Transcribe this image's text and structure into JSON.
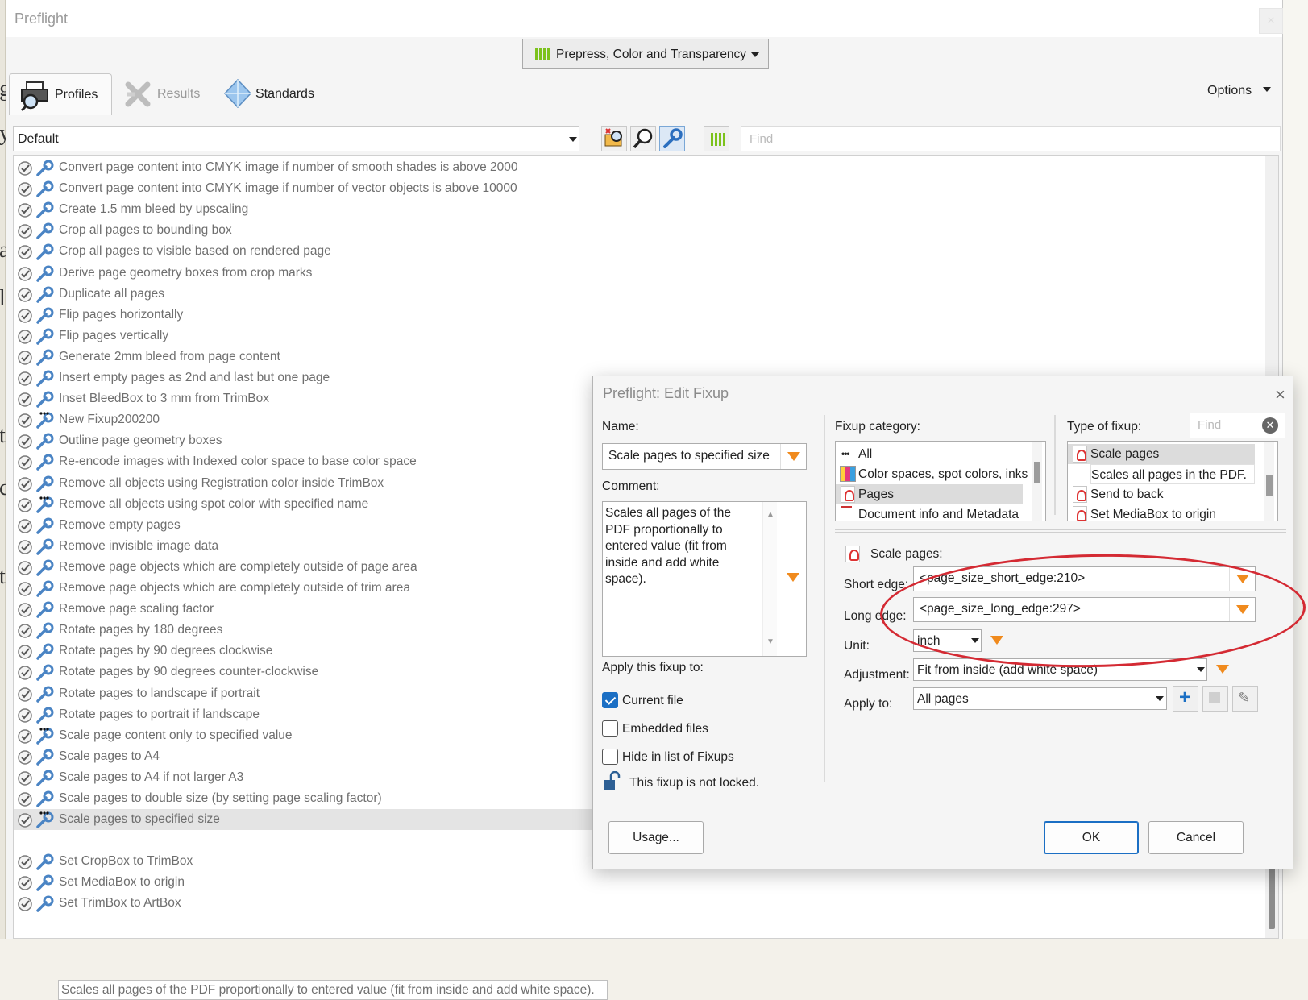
{
  "background": {
    "letters": [
      "g",
      "y",
      "a",
      "l",
      "t",
      "c",
      "t"
    ]
  },
  "window": {
    "title": "Preflight",
    "close_glyph": "×"
  },
  "profile_dropdown": {
    "label": "Prepress, Color and Transparency"
  },
  "tabs": [
    {
      "label": "Profiles",
      "icon": "printer-magnifier-icon"
    },
    {
      "label": "Results",
      "icon": "results-cross-icon"
    },
    {
      "label": "Standards",
      "icon": "diamond-icon"
    }
  ],
  "options_label": "Options",
  "filter": {
    "value": "Default"
  },
  "toolbar": {
    "find_placeholder": "Find"
  },
  "fixups": [
    "Convert page content into CMYK image if number of smooth shades is above 2000",
    "Convert page content into CMYK image if number of vector objects is above 10000",
    "Create 1.5 mm bleed by upscaling",
    "Crop all pages to bounding box",
    "Crop all pages to visible based on rendered page",
    "Derive page geometry boxes from crop marks",
    "Duplicate all pages",
    "Flip pages horizontally",
    "Flip pages vertically",
    "Generate 2mm bleed from page content",
    "Insert empty pages as 2nd and last but one page",
    "Inset BleedBox to 3 mm from TrimBox",
    "New Fixup200200",
    "Outline page geometry boxes",
    "Re-encode images with Indexed color space to base color space",
    "Remove all objects using Registration color inside TrimBox",
    "Remove all objects using spot color with specified name",
    "Remove empty pages",
    "Remove invisible image data",
    "Remove page objects which are completely outside of page area",
    "Remove page objects which are completely outside of trim area",
    "Remove page scaling factor",
    "Rotate pages by 180 degrees",
    "Rotate pages by 90 degrees clockwise",
    "Rotate pages by 90 degrees counter-clockwise",
    "Rotate pages to landscape if portrait",
    "Rotate pages to portrait if landscape",
    "Scale page content only to specified value",
    "Scale pages to A4",
    "Scale pages to A4 if not larger A3",
    "Scale pages to double size (by setting page scaling factor)",
    "Scale pages to specified size",
    "Set CropBox to TrimBox",
    "Set MediaBox to origin",
    "Set TrimBox to ArtBox"
  ],
  "fixups_dotted": [
    12,
    16,
    27,
    31
  ],
  "selected_fixup": 31,
  "selected_description": "Scales all pages of the PDF proportionally to entered value (fit from inside and add white space).",
  "dialog": {
    "title": "Preflight: Edit Fixup",
    "name_label": "Name:",
    "name_value": "Scale pages to specified size",
    "comment_label": "Comment:",
    "comment_text": "Scales all pages of the PDF proportionally to entered value (fit from inside and add white space).",
    "apply_label": "Apply this fixup to:",
    "current_file": "Current file",
    "embedded_files": "Embedded files",
    "hide_in_list": "Hide in list of Fixups",
    "lock_text": "This fixup is not locked.",
    "usage_button": "Usage...",
    "ok_button": "OK",
    "cancel_button": "Cancel",
    "category_label": "Fixup category:",
    "categories": [
      "All",
      "Color spaces, spot colors, inks",
      "Pages",
      "Document info and Metadata"
    ],
    "category_selected": 2,
    "type_label": "Type of fixup:",
    "type_find_placeholder": "Find",
    "types": [
      "Scale pages",
      "Scales all pages in the PDF.",
      "Send to back",
      "Set MediaBox to origin"
    ],
    "type_selected": 0,
    "section_title": "Scale pages:",
    "short_edge_label": "Short edge:",
    "short_edge_value": "<page_size_short_edge:210>",
    "long_edge_label": "Long edge:",
    "long_edge_value": "<page_size_long_edge:297>",
    "unit_label": "Unit:",
    "unit_value": "inch",
    "adjustment_label": "Adjustment:",
    "adjustment_value": "Fit from inside (add white space)",
    "apply_to_label": "Apply to:",
    "apply_to_value": "All pages"
  },
  "colors": {
    "accent": "#1b6fc4",
    "dropdown_arrow": "#f08a1d",
    "annotation": "#d42a33",
    "green_bars": "#7cc21c"
  }
}
